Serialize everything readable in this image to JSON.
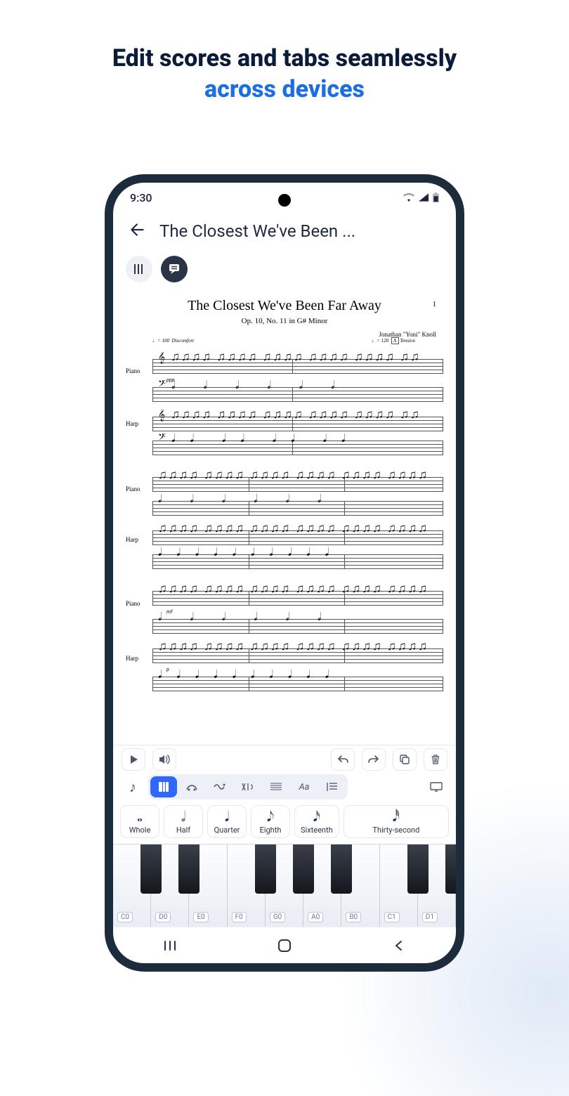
{
  "promo": {
    "line1": "Edit scores and tabs seamlessly",
    "line2": "across devices"
  },
  "statusbar": {
    "time": "9:30"
  },
  "header": {
    "title": "The Closest We've Been ..."
  },
  "score": {
    "page_number": "1",
    "title": "The Closest We've Been Far Away",
    "subtitle": "Op. 10, No. 11 in G# Minor",
    "composer": "Jonathan \"Yoni\" Knoll",
    "tempo1": "♩= 100",
    "tempo2": "♩= 120",
    "mark1": "Discomfort",
    "mark2": "Tension",
    "rehearsal": "A",
    "instruments": {
      "piano": "Piano",
      "harp": "Harp"
    },
    "dynamics": {
      "ppp": "ppp",
      "mf": "mf",
      "p": "p"
    }
  },
  "categories": {
    "text_tool_label": "Aa"
  },
  "durations": [
    {
      "glyph": "𝅝",
      "label": "Whole"
    },
    {
      "glyph": "𝅗𝅥",
      "label": "Half"
    },
    {
      "glyph": "𝅘𝅥",
      "label": "Quarter"
    },
    {
      "glyph": "𝅘𝅥𝅮",
      "label": "Eighth"
    },
    {
      "glyph": "𝅘𝅥𝅯",
      "label": "Sixteenth"
    },
    {
      "glyph": "𝅘𝅥𝅰",
      "label": "Thirty-second"
    }
  ],
  "piano": {
    "whites": [
      "C0",
      "D0",
      "E0",
      "F0",
      "G0",
      "A0",
      "B0",
      "C1",
      "D1"
    ]
  }
}
